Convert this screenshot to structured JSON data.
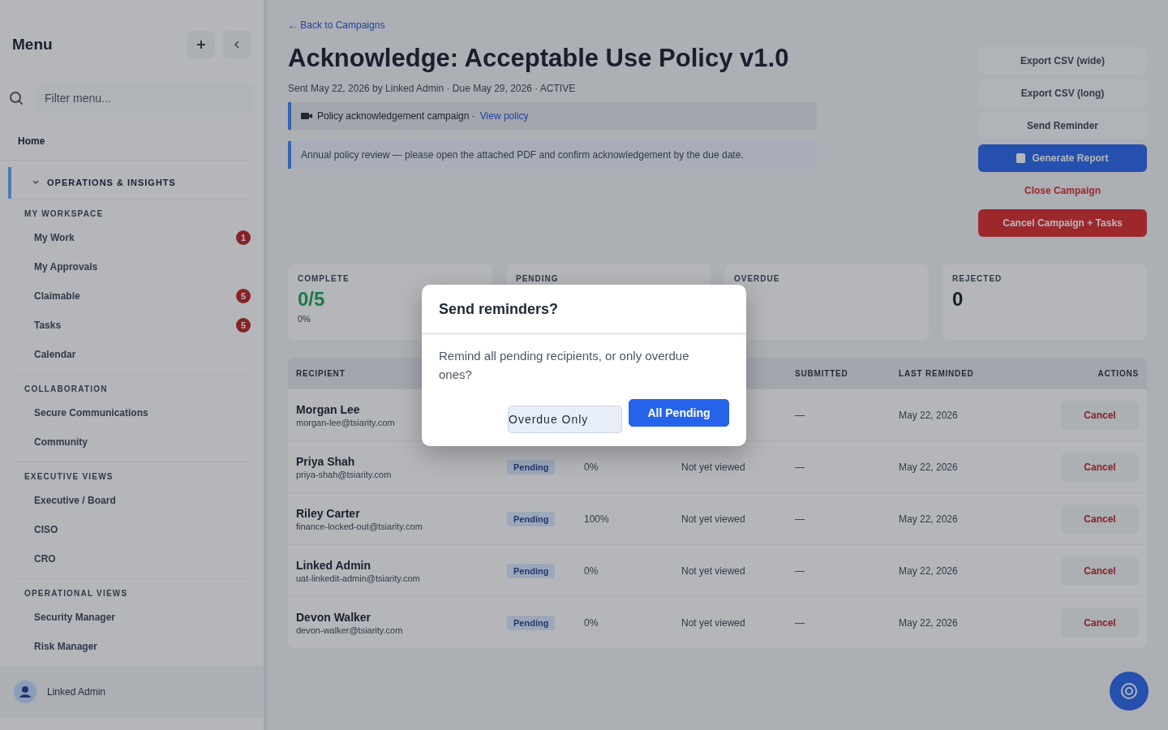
{
  "sidebar": {
    "title": "Menu",
    "filter": {
      "placeholder": "Filter menu..."
    },
    "home": "Home",
    "section": {
      "label": "OPERATIONS & INSIGHTS",
      "expanded": true
    },
    "groups": [
      {
        "label": "MY WORKSPACE",
        "items": [
          {
            "label": "My Work",
            "badge": "1"
          },
          {
            "label": "My Approvals"
          },
          {
            "label": "Claimable",
            "badge": "5"
          },
          {
            "label": "Tasks",
            "badge": "5"
          },
          {
            "label": "Calendar"
          }
        ]
      },
      {
        "label": "COLLABORATION",
        "items": [
          {
            "label": "Secure Communications"
          },
          {
            "label": "Community"
          }
        ]
      },
      {
        "label": "EXECUTIVE VIEWS",
        "items": [
          {
            "label": "Executive / Board"
          },
          {
            "label": "CISO"
          },
          {
            "label": "CRO"
          }
        ]
      },
      {
        "label": "OPERATIONAL VIEWS",
        "items": [
          {
            "label": "Security Manager"
          },
          {
            "label": "Risk Manager"
          }
        ]
      }
    ],
    "user": "Linked Admin"
  },
  "main": {
    "back": "← Back to Campaigns",
    "title": "Acknowledge: Acceptable Use Policy v1.0",
    "meta": "Sent May 22, 2026 by Linked Admin · Due May 29, 2026 · ACTIVE",
    "info": "Policy acknowledgement campaign ·",
    "info_link": "View policy",
    "note": "Annual policy review — please open the attached PDF and confirm acknowledgement by the due date.",
    "actions": [
      {
        "label": "Export CSV (wide)",
        "kind": "plain"
      },
      {
        "label": "Export CSV (long)",
        "kind": "plain"
      },
      {
        "label": "Send Reminder",
        "kind": "plain"
      },
      {
        "label": "Generate Report",
        "kind": "primary"
      },
      {
        "label": "Close Campaign",
        "kind": "danger-text"
      },
      {
        "label": "Cancel Campaign + Tasks",
        "kind": "danger"
      }
    ],
    "stats": [
      {
        "label": "COMPLETE",
        "value": "0/5",
        "sub": "0%",
        "kind": "success"
      },
      {
        "label": "PENDING"
      },
      {
        "label": "OVERDUE"
      },
      {
        "label": "REJECTED",
        "value": "0",
        "kind": "plain"
      }
    ],
    "table": {
      "headers": {
        "recipient": "RECIPIENT",
        "submitted": "SUBMITTED",
        "last_reminded": "LAST REMINDED",
        "actions": "ACTIONS"
      },
      "rows": [
        {
          "name": "Morgan Lee",
          "email": "morgan-lee@tsiarity.com",
          "submitted": "—",
          "last_reminded": "May 22, 2026",
          "action": "Cancel"
        },
        {
          "name": "Priya Shah",
          "email": "priya-shah@tsiarity.com",
          "status": "Pending",
          "progress": "0%",
          "viewed": "Not yet viewed",
          "submitted": "—",
          "last_reminded": "May 22, 2026",
          "action": "Cancel"
        },
        {
          "name": "Riley Carter",
          "email": "finance-locked-out@tsiarity.com",
          "status": "Pending",
          "progress": "100%",
          "viewed": "Not yet viewed",
          "submitted": "—",
          "last_reminded": "May 22, 2026",
          "action": "Cancel"
        },
        {
          "name": "Linked Admin",
          "email": "uat-linkedit-admin@tsiarity.com",
          "status": "Pending",
          "progress": "0%",
          "viewed": "Not yet viewed",
          "submitted": "—",
          "last_reminded": "May 22, 2026",
          "action": "Cancel"
        },
        {
          "name": "Devon Walker",
          "email": "devon-walker@tsiarity.com",
          "status": "Pending",
          "progress": "0%",
          "viewed": "Not yet viewed",
          "submitted": "—",
          "last_reminded": "May 22, 2026",
          "action": "Cancel"
        }
      ]
    }
  },
  "dialog": {
    "title": "Send reminders?",
    "message": "Remind all pending recipients, or only overdue ones?",
    "buttons": [
      {
        "label": "Overdue Only",
        "kind": "secondary"
      },
      {
        "label": "All Pending",
        "kind": "primary"
      }
    ]
  }
}
